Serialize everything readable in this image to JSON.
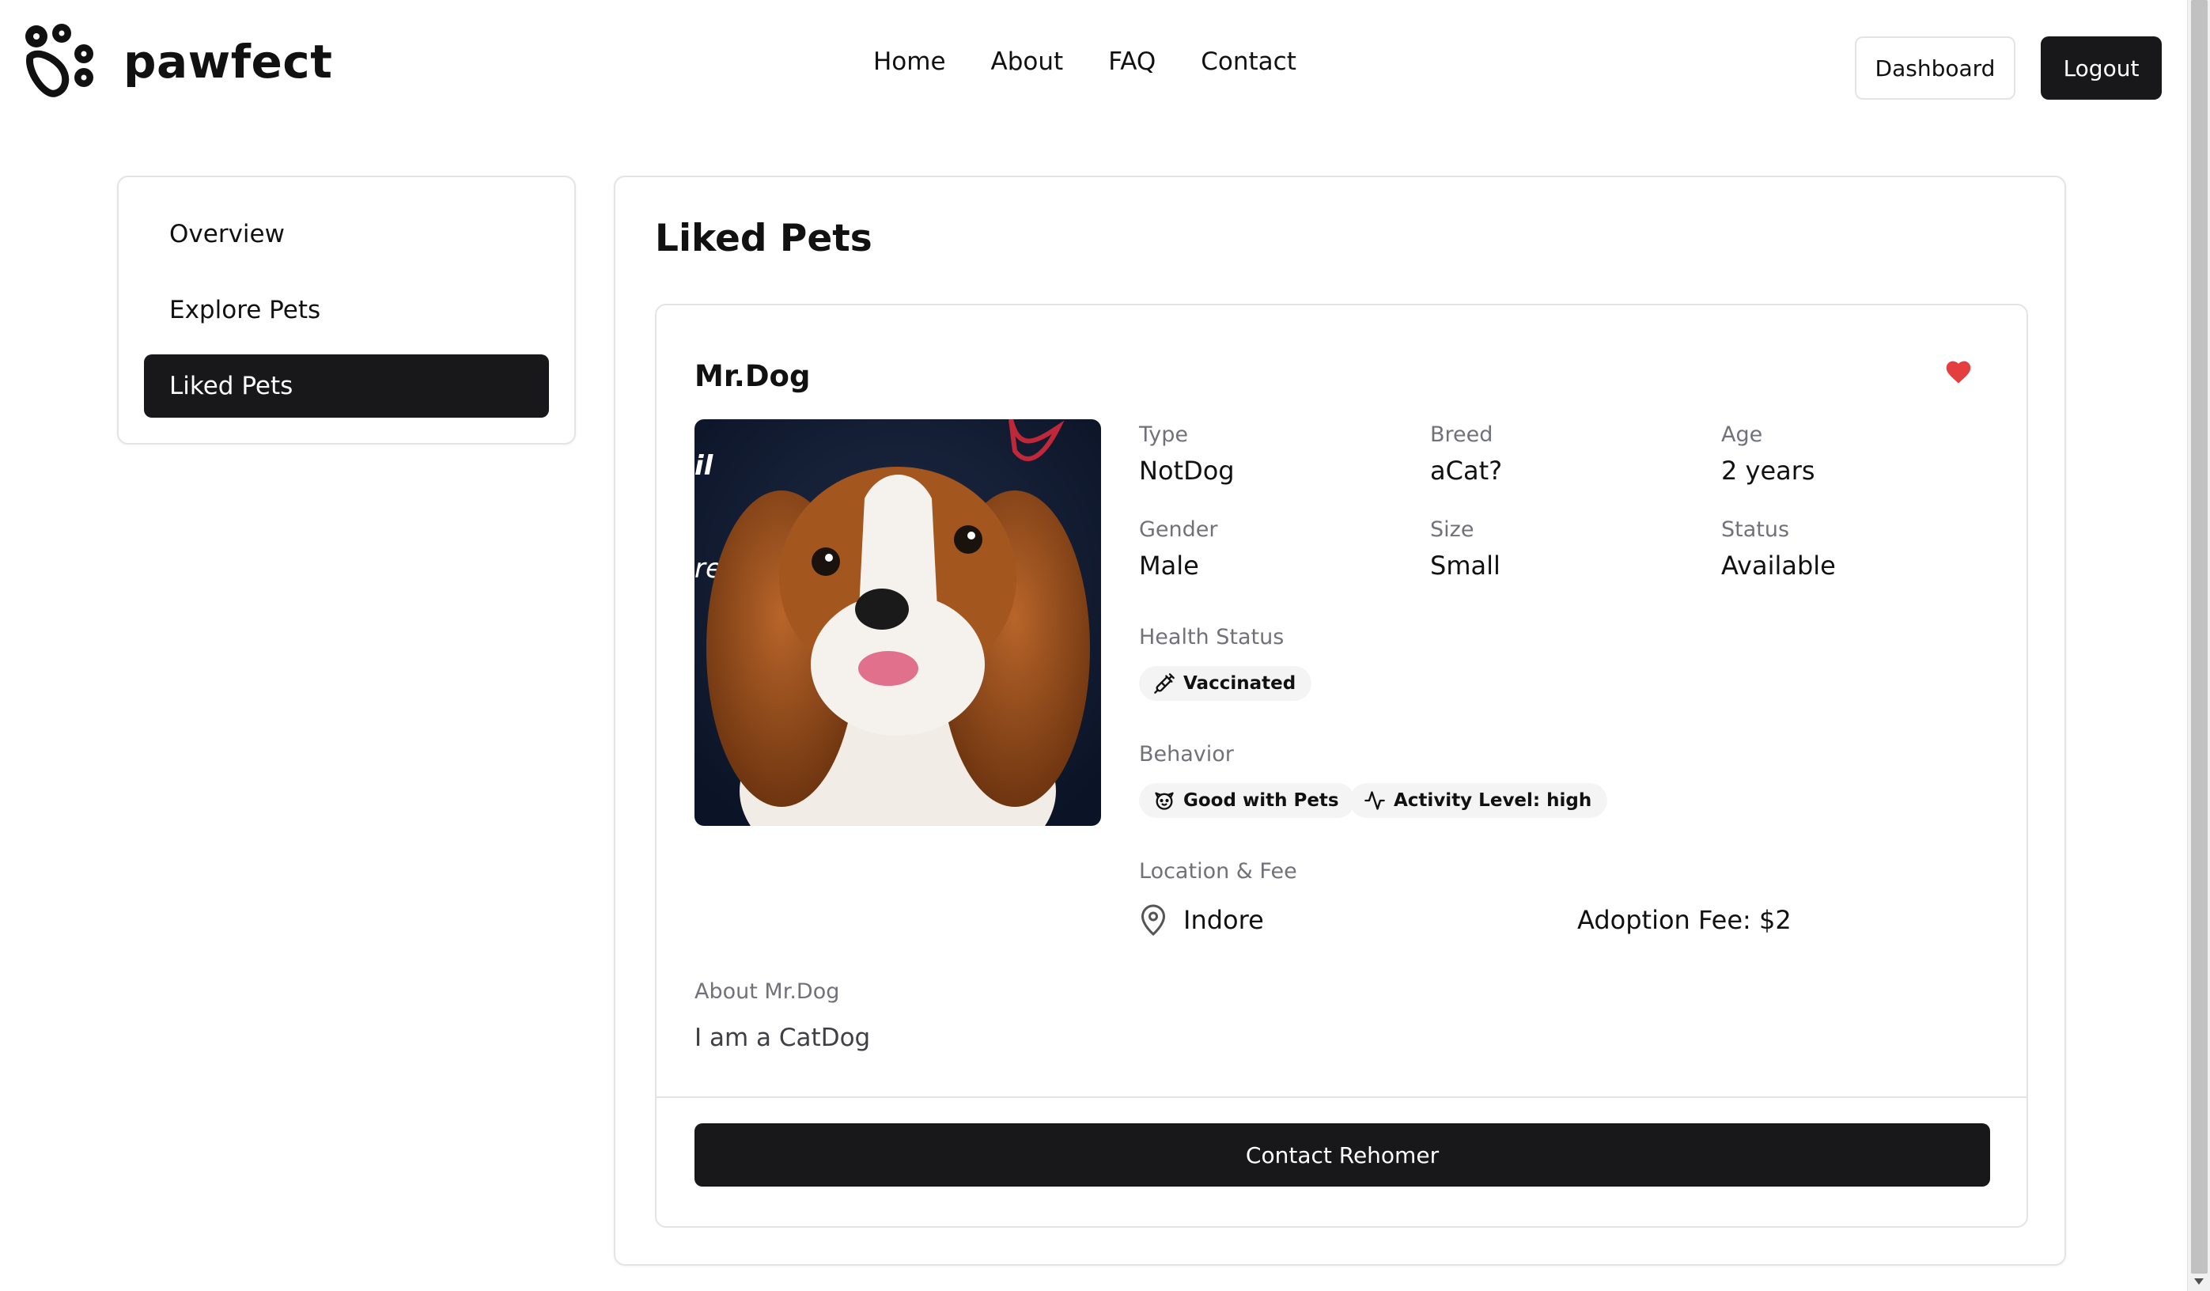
{
  "brand": {
    "name": "pawfect",
    "logo_icon": "paw-logo-icon"
  },
  "nav": {
    "items": [
      "Home",
      "About",
      "FAQ",
      "Contact"
    ]
  },
  "header_buttons": {
    "dashboard": "Dashboard",
    "logout": "Logout"
  },
  "sidebar": {
    "items": [
      {
        "label": "Overview",
        "active": false
      },
      {
        "label": "Explore Pets",
        "active": false
      },
      {
        "label": "Liked Pets",
        "active": true
      }
    ]
  },
  "main": {
    "title": "Liked Pets"
  },
  "pet": {
    "name": "Mr.Dog",
    "liked": true,
    "fields": {
      "type": {
        "label": "Type",
        "value": "NotDog"
      },
      "breed": {
        "label": "Breed",
        "value": "aCat?"
      },
      "age": {
        "label": "Age",
        "value": "2 years"
      },
      "gender": {
        "label": "Gender",
        "value": "Male"
      },
      "size": {
        "label": "Size",
        "value": "Small"
      },
      "status": {
        "label": "Status",
        "value": "Available"
      }
    },
    "health": {
      "label": "Health Status",
      "badges": [
        {
          "icon": "syringe-icon",
          "text": "Vaccinated"
        }
      ]
    },
    "behavior": {
      "label": "Behavior",
      "badges": [
        {
          "icon": "dog-face-icon",
          "text": "Good with Pets"
        },
        {
          "icon": "activity-icon",
          "text": "Activity Level: high"
        }
      ]
    },
    "location_fee": {
      "label": "Location & Fee",
      "location": "Indore",
      "fee": "Adoption Fee: $2"
    },
    "about": {
      "label": "About Mr.Dog",
      "text": "I am a CatDog"
    },
    "contact_button": "Contact Rehomer"
  },
  "colors": {
    "primary": "#18181b",
    "muted": "#71717a",
    "border": "#e4e4e7",
    "heart": "#e53e3e",
    "badge_bg": "#f4f4f5"
  }
}
